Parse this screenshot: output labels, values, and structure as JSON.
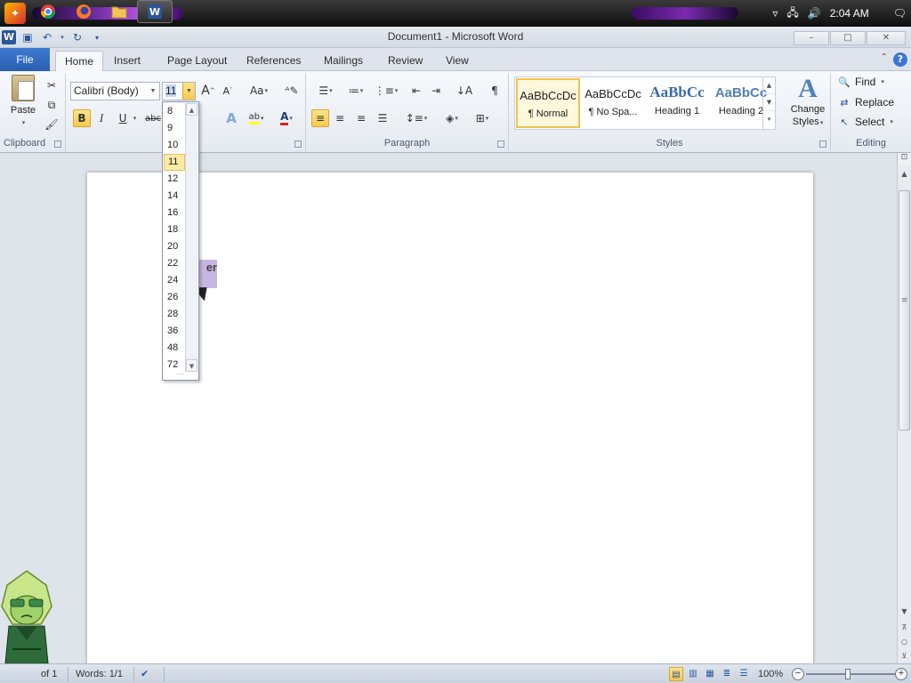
{
  "taskbar": {
    "clock": "2:04 AM",
    "tray_icons": [
      "arrow-up-icon",
      "network-icon",
      "volume-icon"
    ],
    "notification_icon": "notification-icon",
    "pinned": [
      "start-icon",
      "chrome-icon",
      "firefox-icon",
      "folder-icon",
      "word-icon"
    ]
  },
  "window": {
    "title": "Document1 - Microsoft Word",
    "app_icon_letter": "W",
    "controls": [
      "–",
      "□",
      "✕"
    ]
  },
  "quick_access": [
    "save-icon",
    "undo-icon",
    "redo-icon",
    "customize-icon"
  ],
  "ribbon": {
    "tabs": [
      "File",
      "Home",
      "Insert",
      "Page Layout",
      "References",
      "Mailings",
      "Review",
      "View"
    ],
    "active_tab": "Home",
    "groups": {
      "clipboard": {
        "label": "Clipboard",
        "paste_label": "Paste"
      },
      "font": {
        "font_name": "Calibri (Body)",
        "font_size": "11",
        "bold": "B",
        "italic": "I",
        "underline": "U",
        "strikethrough": "abc",
        "grow_font": "A",
        "shrink_font": "A",
        "change_case": "Aa",
        "font_color_letter": "A"
      },
      "paragraph": {
        "label": "Paragraph",
        "show_marks": "¶"
      },
      "styles": {
        "label": "Styles",
        "items": [
          {
            "sample": "AaBbCcDc",
            "name": "¶ Normal"
          },
          {
            "sample": "AaBbCcDc",
            "name": "¶ No Spa..."
          },
          {
            "sample": "AaBbCc",
            "name": "Heading 1"
          },
          {
            "sample": "AaBbCc",
            "name": "Heading 2"
          }
        ],
        "change_styles_line1": "Change",
        "change_styles_line2": "Styles"
      },
      "editing": {
        "label": "Editing",
        "find": "Find",
        "replace": "Replace",
        "select": "Select"
      }
    }
  },
  "font_size_dropdown": {
    "options": [
      "8",
      "9",
      "10",
      "11",
      "12",
      "14",
      "16",
      "18",
      "20",
      "22",
      "24",
      "26",
      "28",
      "36",
      "48",
      "72"
    ],
    "selected": "11"
  },
  "document": {
    "selected_text_fragment": "er"
  },
  "statusbar": {
    "page": "of 1",
    "words": "Words: 1/1",
    "zoom": "100%"
  },
  "colors": {
    "file_tab": "#2a5fb0",
    "highlight": "#f8c94d",
    "selection": "#c8b6e2",
    "font_color_underline": "#e02020",
    "highlight_underline": "#ffff00"
  }
}
